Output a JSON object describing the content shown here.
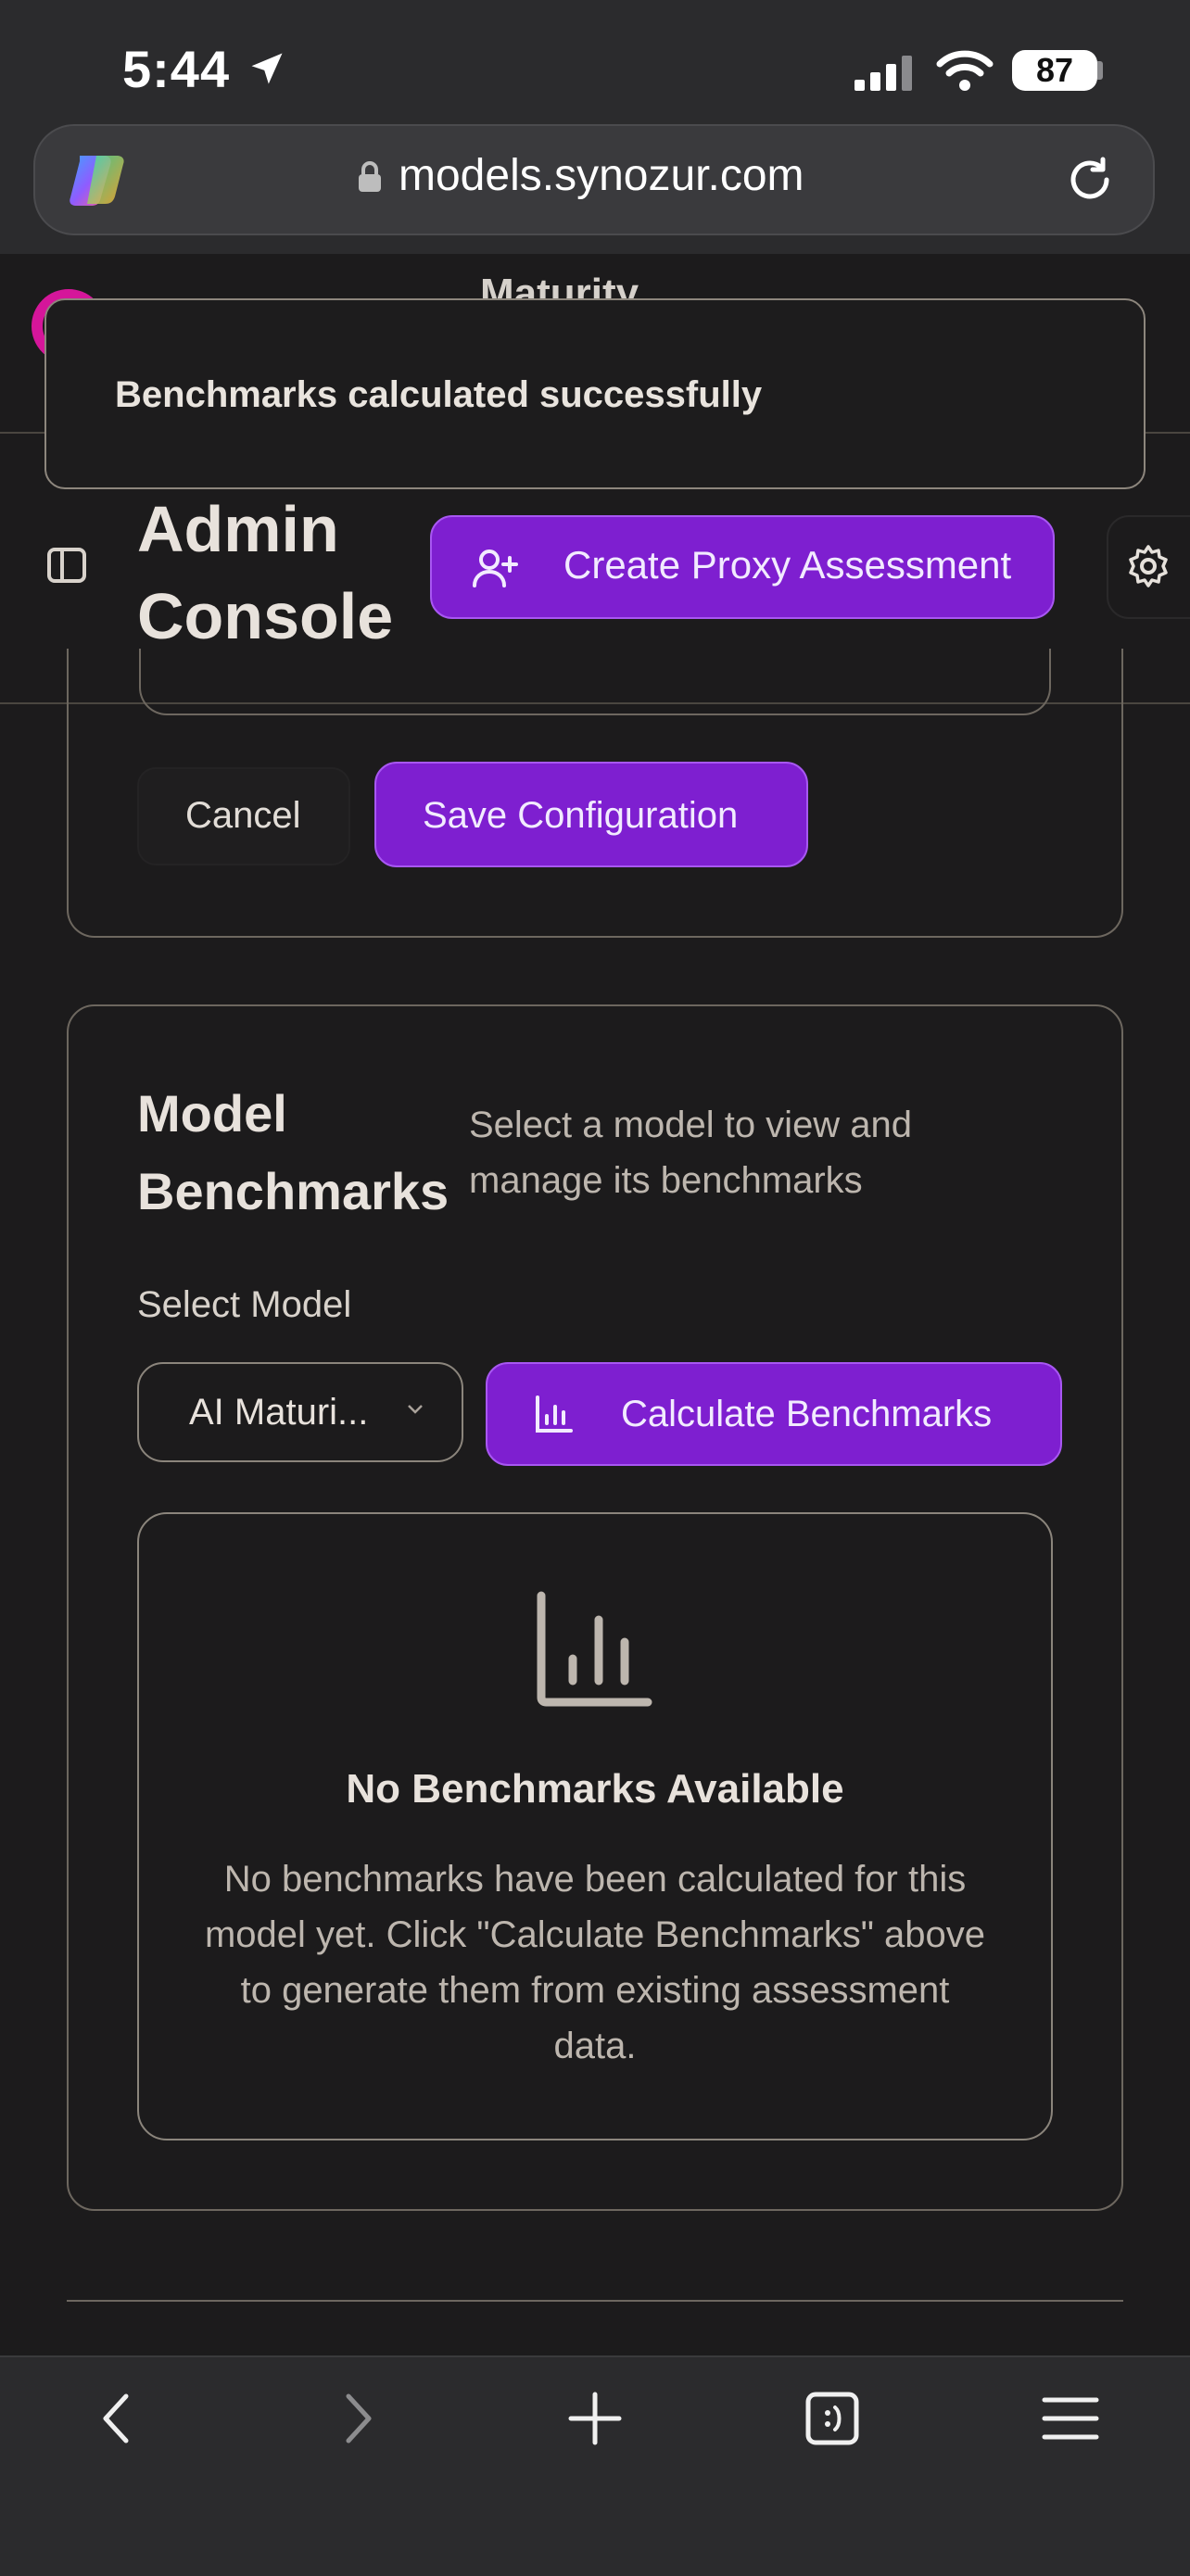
{
  "status_bar": {
    "time": "5:44",
    "battery": "87"
  },
  "browser": {
    "url": "models.synozur.com"
  },
  "site_header": {
    "partial_title": "Maturity"
  },
  "toast": {
    "message": "Benchmarks calculated successfully"
  },
  "admin": {
    "title_line1": "Admin",
    "title_line2": "Console",
    "proxy_button": "Create Proxy Assessment"
  },
  "config": {
    "cancel_label": "Cancel",
    "save_label": "Save Configuration"
  },
  "benchmarks": {
    "title_line1": "Model",
    "title_line2": "Benchmarks",
    "subtitle": "Select a model to view and manage its benchmarks",
    "select_label": "Select Model",
    "selected_model": "AI Maturi...",
    "calculate_button": "Calculate Benchmarks",
    "empty_title": "No Benchmarks Available",
    "empty_text": "No benchmarks have been calculated for this model yet. Click \"Calculate Benchmarks\" above to generate them from existing assessment data."
  },
  "icons": {
    "location": "location-arrow-icon",
    "signal": "cellular-signal-icon",
    "wifi": "wifi-icon",
    "copilot": "copilot-logo-icon",
    "lock": "lock-icon",
    "reload": "reload-icon",
    "sidebar": "sidebar-toggle-icon",
    "user_plus": "user-plus-icon",
    "settings": "gear-icon",
    "chart": "bar-chart-icon",
    "chevron": "chevron-down-icon",
    "back": "chevron-left-icon",
    "forward": "chevron-right-icon",
    "new_tab": "plus-icon",
    "tabs": "tabs-icon",
    "menu": "hamburger-menu-icon"
  },
  "colors": {
    "accent": "#7e1fd0",
    "accent_border": "#a857f2",
    "background": "#1c1b1c",
    "logo_pink": "#d5169a"
  }
}
